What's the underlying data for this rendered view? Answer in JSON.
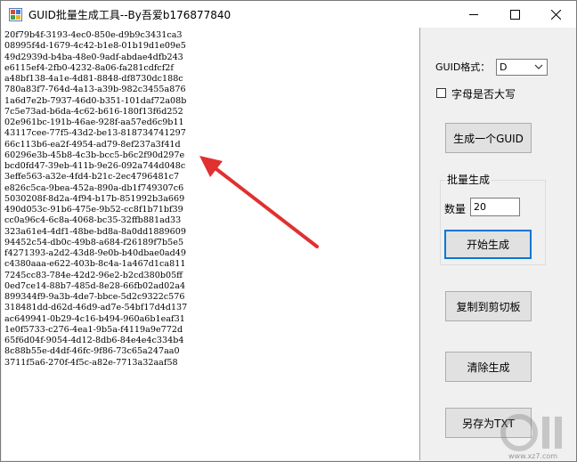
{
  "window": {
    "title": "GUID批量生成工具--By吾爱b176877840"
  },
  "output": {
    "guids": [
      "20f79b4f-3193-4ec0-850e-d9b9c3431ca3",
      "08995f4d-1679-4c42-b1e8-01b19d1e09e5",
      "49d2939d-b4ba-48e0-9adf-abdae4dfb243",
      "e6115ef4-2fb0-4232-8a06-fa281cdfcf2f",
      "a48bf138-4a1e-4d81-8848-df8730dc188c",
      "780a83f7-764d-4a13-a39b-982c3455a876",
      "1a6d7e2b-7937-46d0-b351-101daf72a08b",
      "7c5e73ad-b6da-4c62-b616-180f13f6d252",
      "02e961bc-191b-46ae-928f-aa57ed6c9b11",
      "43117cee-77f5-43d2-be13-818734741297",
      "66c113b6-ea2f-4954-ad79-8ef237a3f41d",
      "60296e3b-45b8-4c3b-bcc5-b6c2f90d297e",
      "bcd0fd47-39eb-411b-9e26-092a744d048c",
      "3effe563-a32e-4fd4-b21c-2ec4796481c7",
      "e826c5ca-9bea-452a-890a-db1f749307c6",
      "5030208f-8d2a-4f94-b17b-851992b3a669",
      "490d053c-91b6-475e-9b52-cc8f1b71bf39",
      "cc0a96c4-6c8a-4068-bc35-32ffb881ad33",
      "323a61e4-4df1-48be-bd8a-8a0dd1889609",
      "94452c54-db0c-49b8-a684-f26189f7b5e5",
      "f4271393-a2d2-43d8-9e0b-b40dbae0ad49",
      "c4380aaa-e622-403b-8c4a-1a467d1ca811",
      "7245cc83-784e-42d2-96e2-b2cd380b05ff",
      "0ed7ce14-88b7-485d-8e28-66fb02ad02a4",
      "899344f9-9a3b-4de7-bbce-5d2c9322c576",
      "318481dd-d62d-46d9-ad7e-54bf17d4d137",
      "ac649941-0b29-4c16-b494-960a6b1eaf31",
      "1e0f5733-c276-4ea1-9b5a-f4119a9e772d",
      "65f6d04f-9054-4d12-8db6-84e4e4c334b4",
      "8c88b55e-d4df-46fc-9f86-73c65a247aa0",
      "3711f5a6-270f-4f5c-a82e-7713a32aaf58"
    ]
  },
  "controls": {
    "format_label": "GUID格式：",
    "format_value": "D",
    "uppercase_label": "字母是否大写",
    "uppercase_checked": false,
    "single_button": "生成一个GUID",
    "batch_group_title": "批量生成",
    "count_label": "数量",
    "count_value": "20",
    "start_button": "开始生成",
    "copy_button": "复制到剪切板",
    "clear_button": "清除生成",
    "save_button": "另存为TXT"
  },
  "watermark": {
    "url": "www.xz7.com"
  },
  "colors": {
    "arrow": "#e03030",
    "accent_border": "#0078d7"
  }
}
